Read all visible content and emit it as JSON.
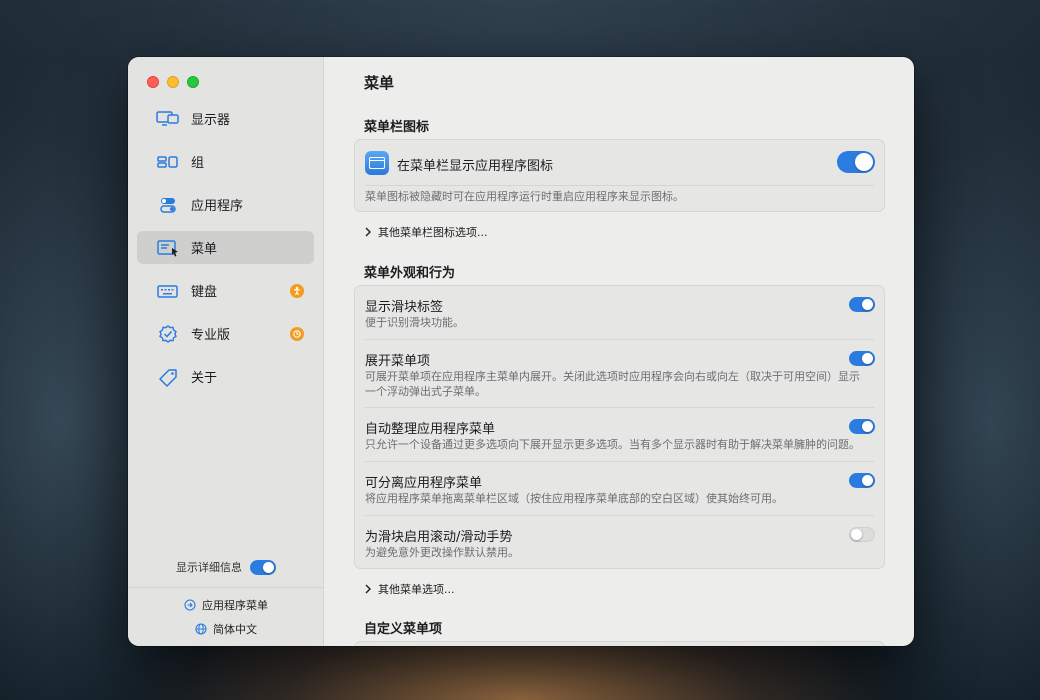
{
  "sidebar": {
    "items": [
      {
        "label": "显示器",
        "icon": "display-icon"
      },
      {
        "label": "组",
        "icon": "group-icon"
      },
      {
        "label": "应用程序",
        "icon": "app-toggles-icon"
      },
      {
        "label": "菜单",
        "icon": "menu-cursor-icon",
        "active": true
      },
      {
        "label": "键盘",
        "icon": "keyboard-icon",
        "badge": "accessibility-badge-icon"
      },
      {
        "label": "专业版",
        "icon": "verified-badge-icon",
        "badge": "clock-badge-icon"
      },
      {
        "label": "关于",
        "icon": "tag-icon"
      }
    ],
    "detail_label": "显示详细信息",
    "detail_toggle": "on",
    "footer": {
      "app_menu_label": "应用程序菜单",
      "language_label": "简体中文"
    }
  },
  "main": {
    "title": "菜单",
    "menubar_icon_section": {
      "title": "菜单栏图标",
      "row_label": "在菜单栏显示应用程序图标",
      "row_toggle": "on",
      "description": "菜单图标被隐藏时可在应用程序运行时重启应用程序来显示图标。",
      "more_link": "其他菜单栏图标选项..."
    },
    "appearance_section": {
      "title": "菜单外观和行为",
      "rows": [
        {
          "title": "显示滑块标签",
          "desc": "便于识别滑块功能。",
          "toggle": "on"
        },
        {
          "title": "展开菜单项",
          "desc": "可展开菜单项在应用程序主菜单内展开。关闭此选项时应用程序会向右或向左（取决于可用空间）显示一个浮动弹出式子菜单。",
          "toggle": "on"
        },
        {
          "title": "自动整理应用程序菜单",
          "desc": "只允许一个设备通过更多选项向下展开显示更多选项。当有多个显示器时有助于解决菜单臃肿的问题。",
          "toggle": "on"
        },
        {
          "title": "可分离应用程序菜单",
          "desc": "将应用程序菜单拖离菜单栏区域（按住应用程序菜单底部的空白区域）使其始终可用。",
          "toggle": "on"
        },
        {
          "title": "为滑块启用滚动/滑动手势",
          "desc": "为避免意外更改操作默认禁用。",
          "toggle": "off"
        }
      ],
      "more_link": "其他菜单选项..."
    },
    "custom_section": {
      "title": "自定义菜单项"
    }
  },
  "colors": {
    "accent": "#2c7be0",
    "badge": "#f39c1f",
    "window_bg": "#ededeb",
    "sidebar_bg": "#e3e3e1"
  }
}
